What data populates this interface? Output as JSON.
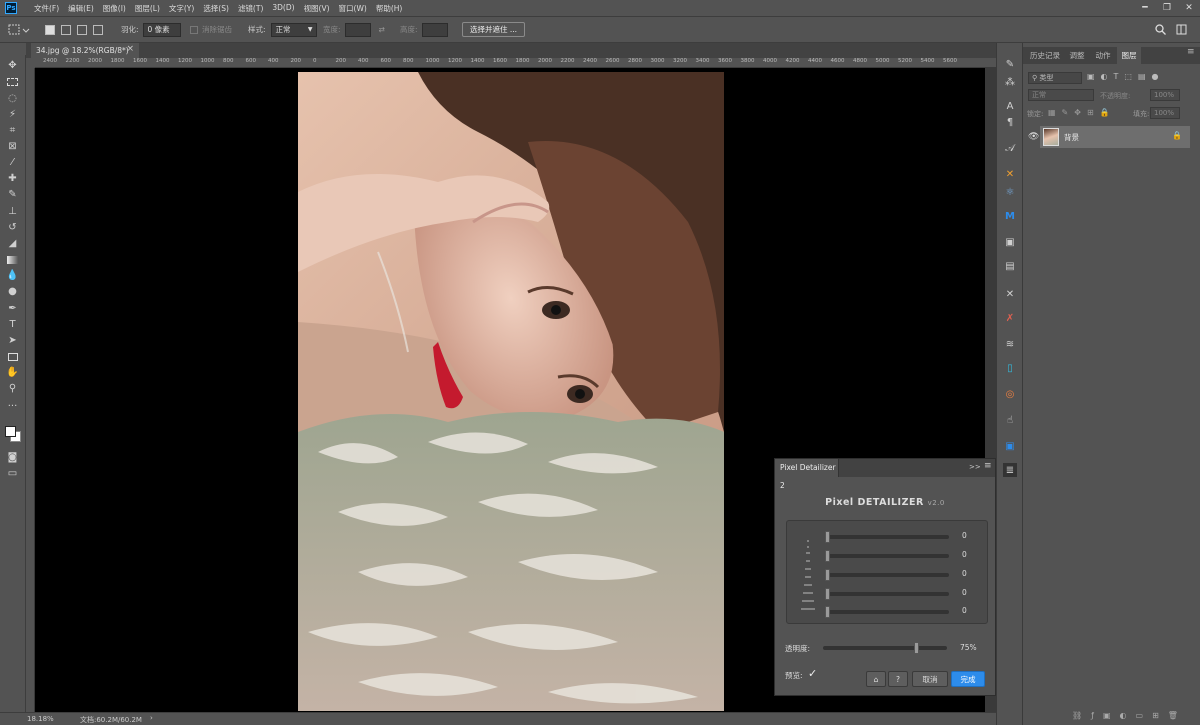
{
  "menubar": {
    "logo": "Ps",
    "items": [
      "文件(F)",
      "编辑(E)",
      "图像(I)",
      "图层(L)",
      "文字(Y)",
      "选择(S)",
      "滤镜(T)",
      "3D(D)",
      "视图(V)",
      "窗口(W)",
      "帮助(H)"
    ],
    "minimize": "━",
    "restore": "❐",
    "close": "✕"
  },
  "options": {
    "feather_label": "羽化:",
    "feather_value": "0 像素",
    "antialias_label": "消除锯齿",
    "style_label": "样式:",
    "style_value": "正常",
    "width_label": "宽度:",
    "height_label": "高度:",
    "select_mask": "选择并遮住 ..."
  },
  "document": {
    "tab_title": "34.jpg @ 18.2%(RGB/8*)",
    "tab_close": "×"
  },
  "ruler": {
    "labels": [
      "2400",
      "2200",
      "2000",
      "1800",
      "1600",
      "1400",
      "1200",
      "1000",
      "800",
      "600",
      "400",
      "200",
      "0",
      "200",
      "400",
      "600",
      "800",
      "1000",
      "1200",
      "1400",
      "1600",
      "1800",
      "2000",
      "2200",
      "2400",
      "2600",
      "2800",
      "3000",
      "3200",
      "3400",
      "3600",
      "3800",
      "4000",
      "4200",
      "4400",
      "4600",
      "4800",
      "5000",
      "5200",
      "5400",
      "5600"
    ]
  },
  "status": {
    "zoom": "18.18%",
    "doc": "文档:60.2M/60.2M",
    "arrow": "›"
  },
  "layers_panel": {
    "tabs": [
      "历史记录",
      "调整",
      "动作",
      "图层"
    ],
    "active_tab": "图层",
    "kind_label": "类型",
    "blend_mode": "正常",
    "opacity_label": "不透明度:",
    "opacity_value": "100%",
    "lock_label": "锁定:",
    "fill_label": "填充:",
    "fill_value": "100%",
    "layer_name": "背景",
    "bottom_icons": [
      "link",
      "fx",
      "mask",
      "adjust",
      "group",
      "new",
      "trash"
    ]
  },
  "plugin": {
    "tab_title": "Pixel Detailizer 2",
    "collapse": ">>",
    "menu": "≡",
    "heading": "Pixel DETAILIZER",
    "version": "v2.0",
    "sliders": [
      {
        "value": "0"
      },
      {
        "value": "0"
      },
      {
        "value": "0"
      },
      {
        "value": "0"
      },
      {
        "value": "0"
      }
    ],
    "opacity_label": "透明度:",
    "opacity_value": "75%",
    "opacity_level": 0.75,
    "preview_label": "预览:",
    "preview_check": "✓",
    "help": "?",
    "cancel": "取消",
    "ok": "完成"
  },
  "colors": {
    "ui_bg": "#535353",
    "accent_blue": "#2d8ceb"
  }
}
